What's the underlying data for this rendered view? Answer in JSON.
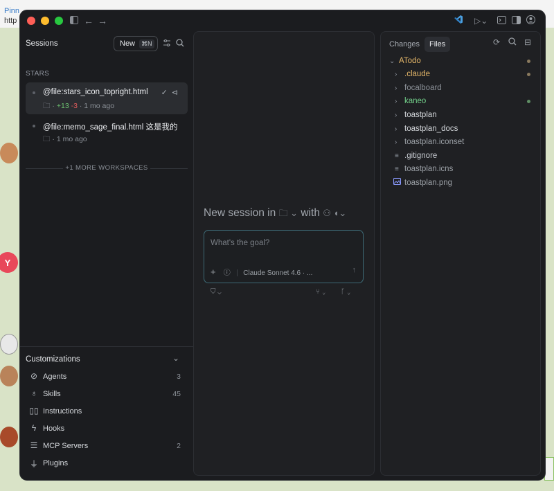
{
  "background": {
    "link_text": "Pinn",
    "url_text": "http",
    "badge_letter": "Y"
  },
  "window": {
    "colors": {
      "accent_green": "#6cc070",
      "accent_red": "#e25c5c",
      "folder_orange": "#e5b769",
      "folder_green": "#73d08a",
      "focus_border": "#3d6a76"
    }
  },
  "titlebar": {
    "icons": [
      "sidebar-toggle-icon",
      "back-arrow-icon",
      "forward-arrow-icon",
      "vscode-icon",
      "run-icon",
      "terminal-icon",
      "panel-icon",
      "account-icon"
    ]
  },
  "sidebar": {
    "title": "Sessions",
    "new_button": {
      "label": "New",
      "shortcut": "⌘N"
    },
    "section_label": "STARS",
    "sessions": [
      {
        "title": "@file:stars_icon_topright.html",
        "plus": "+13",
        "minus": "-3",
        "time": "1 mo ago"
      },
      {
        "title": "@file:memo_sage_final.html 这是我的",
        "time": "1 mo ago"
      }
    ],
    "more_workspaces": "+1 MORE WORKSPACES",
    "customizations": {
      "title": "Customizations",
      "items": [
        {
          "label": "Agents",
          "count": "3",
          "icon": "agents-icon"
        },
        {
          "label": "Skills",
          "count": "45",
          "icon": "lightbulb-icon"
        },
        {
          "label": "Instructions",
          "count": "",
          "icon": "book-icon"
        },
        {
          "label": "Hooks",
          "count": "",
          "icon": "lightning-icon"
        },
        {
          "label": "MCP Servers",
          "count": "2",
          "icon": "server-icon"
        },
        {
          "label": "Plugins",
          "count": "",
          "icon": "plug-icon"
        }
      ]
    }
  },
  "center": {
    "new_session_prefix": "New session in",
    "with_label": "with",
    "goal_placeholder": "What's the goal?",
    "model_label": "Claude Sonnet 4.6 · ..."
  },
  "right_panel": {
    "tabs": [
      {
        "label": "Changes",
        "active": false
      },
      {
        "label": "Files",
        "active": true
      }
    ],
    "tree": {
      "root": "ATodo",
      "items": [
        {
          "label": ".claude",
          "type": "folder",
          "color": "#e5b769",
          "marker": "#8a7a5e"
        },
        {
          "label": "focalboard",
          "type": "folder",
          "color": "#8b9097",
          "marker": ""
        },
        {
          "label": "kaneo",
          "type": "folder",
          "color": "#73d08a",
          "marker": "#5f8e64"
        },
        {
          "label": "toastplan",
          "type": "folder",
          "color": "#d4d7db",
          "marker": ""
        },
        {
          "label": "toastplan_docs",
          "type": "folder",
          "color": "#d4d7db",
          "marker": ""
        },
        {
          "label": "toastplan.iconset",
          "type": "folder",
          "color": "#9ba0a6",
          "marker": ""
        },
        {
          "label": ".gitignore",
          "type": "file",
          "color": "#c6cad0",
          "marker": ""
        },
        {
          "label": "toastplan.icns",
          "type": "file",
          "color": "#9ba0a6",
          "marker": ""
        },
        {
          "label": "toastplan.png",
          "type": "image",
          "color": "#9ba0a6",
          "marker": ""
        }
      ]
    }
  }
}
